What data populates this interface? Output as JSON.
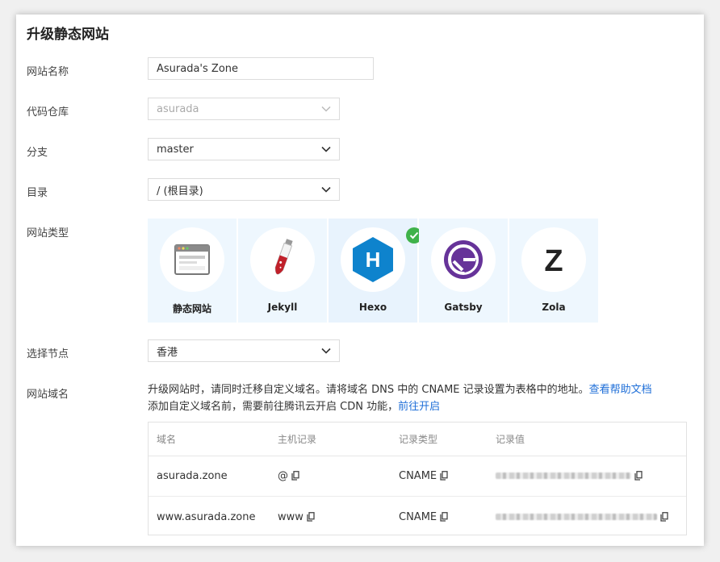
{
  "title": "升级静态网站",
  "form": {
    "site_name": {
      "label": "网站名称",
      "value": "Asurada's Zone"
    },
    "repo": {
      "label": "代码仓库",
      "value": "asurada"
    },
    "branch": {
      "label": "分支",
      "value": "master"
    },
    "dir": {
      "label": "目录",
      "value": "/ (根目录)"
    },
    "site_type": {
      "label": "网站类型",
      "selected": "Hexo",
      "options": [
        {
          "name": "静态网站",
          "icon": "static-site-icon"
        },
        {
          "name": "Jekyll",
          "icon": "jekyll-icon"
        },
        {
          "name": "Hexo",
          "icon": "hexo-icon"
        },
        {
          "name": "Gatsby",
          "icon": "gatsby-icon"
        },
        {
          "name": "Zola",
          "icon": "zola-icon"
        }
      ]
    },
    "node": {
      "label": "选择节点",
      "value": "香港"
    },
    "domain": {
      "label": "网站域名",
      "desc_line1": "升级网站时，请同时迁移自定义域名。请将域名 DNS 中的 CNAME 记录设置为表格中的地址。",
      "help_link": "查看帮助文档",
      "desc_line2": "添加自定义域名前，需要前往腾讯云开启 CDN 功能，",
      "cdn_link": "前往开启",
      "table": {
        "headers": [
          "域名",
          "主机记录",
          "记录类型",
          "记录值"
        ],
        "rows": [
          {
            "domain": "asurada.zone",
            "host": "@",
            "type": "CNAME"
          },
          {
            "domain": "www.asurada.zone",
            "host": "www",
            "type": "CNAME"
          }
        ]
      }
    }
  },
  "colors": {
    "accent": "#1f6fd8",
    "check": "#3fb24a",
    "tile_bg": "#eef7fe"
  }
}
